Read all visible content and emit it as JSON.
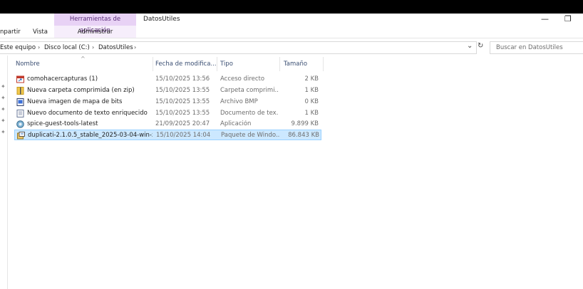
{
  "ribbon": {
    "context_tab": "Herramientas de aplicación",
    "window_title": "DatosUtiles",
    "tabs": [
      "npartir",
      "Vista",
      "Administrar"
    ],
    "minimize": "—",
    "restore": "❐"
  },
  "address": {
    "crumbs": [
      "Este equipo",
      "Disco local (C:)",
      "DatosUtiles"
    ],
    "separator": "›",
    "dropdown": "⌄",
    "refresh": "↻"
  },
  "search": {
    "placeholder": "Buscar en DatosUtiles"
  },
  "columns": {
    "name": "Nombre",
    "date": "Fecha de modifica...",
    "type": "Tipo",
    "size": "Tamaño",
    "sort_indicator": "^"
  },
  "pin_glyph": "✦",
  "files": [
    {
      "name": "comohacercapturas (1)",
      "date": "15/10/2025 13:56",
      "type": "Acceso directo",
      "size": "2 KB",
      "icon": "shortcut-icon",
      "selected": false
    },
    {
      "name": "Nueva carpeta comprimida (en zip)",
      "date": "15/10/2025 13:55",
      "type": "Carpeta comprimi...",
      "size": "1 KB",
      "icon": "zip-folder-icon",
      "selected": false
    },
    {
      "name": "Nueva imagen de mapa de bits",
      "date": "15/10/2025 13:55",
      "type": "Archivo BMP",
      "size": "0 KB",
      "icon": "bitmap-icon",
      "selected": false
    },
    {
      "name": "Nuevo documento de texto enriquecido",
      "date": "15/10/2025 13:55",
      "type": "Documento de tex...",
      "size": "1 KB",
      "icon": "rtf-document-icon",
      "selected": false
    },
    {
      "name": "spice-guest-tools-latest",
      "date": "21/09/2025 20:47",
      "type": "Aplicación",
      "size": "9.899 KB",
      "icon": "application-icon",
      "selected": false
    },
    {
      "name": "duplicati-2.1.0.5_stable_2025-03-04-win-x...",
      "date": "15/10/2025 14:04",
      "type": "Paquete de Windo...",
      "size": "86.843 KB",
      "icon": "msi-package-icon",
      "selected": true
    }
  ],
  "colors": {
    "selection": "#cce8ff",
    "context_tab": "#e8d2f5",
    "header_text": "#3b4f73"
  }
}
